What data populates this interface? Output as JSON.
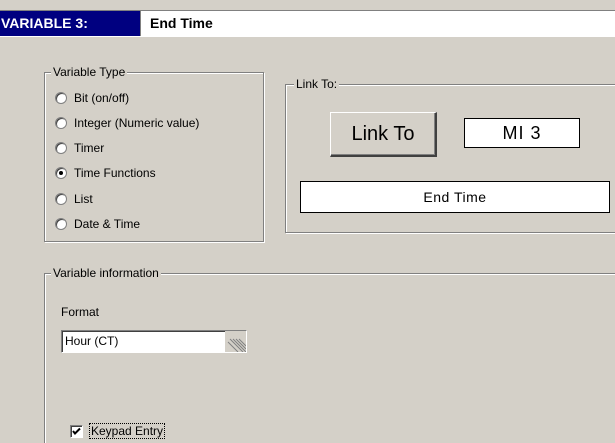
{
  "header": {
    "label": "VARIABLE 3:",
    "value": "End Time"
  },
  "variable_type": {
    "legend": "Variable Type",
    "options": [
      {
        "label": "Bit (on/off)",
        "checked": false
      },
      {
        "label": "Integer (Numeric value)",
        "checked": false
      },
      {
        "label": "Timer",
        "checked": false
      },
      {
        "label": "Time Functions",
        "checked": true
      },
      {
        "label": "List",
        "checked": false
      },
      {
        "label": "Date & Time",
        "checked": false
      }
    ]
  },
  "link_to": {
    "legend": "Link To:",
    "button_label": "Link To",
    "address": "MI  3",
    "description": "End Time"
  },
  "variable_information": {
    "legend": "Variable information",
    "format_label": "Format",
    "format_value": "Hour (CT)",
    "keypad_entry_label": "Keypad Entry",
    "keypad_entry_checked": true
  }
}
